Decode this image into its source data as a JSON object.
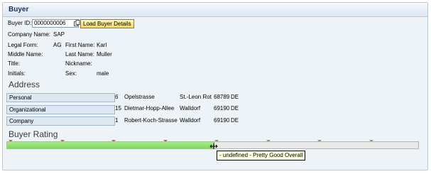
{
  "panel": {
    "title": "Buyer"
  },
  "buyer": {
    "id_label": "Buyer ID:",
    "id_value": "0000000006",
    "load_button": "Load Buyer Details",
    "company_label": "Company Name:",
    "company_value": "SAP",
    "legal_form_label": "Legal Form:",
    "legal_form_value": "AG",
    "first_name_label": "First Name:",
    "first_name_value": "Karl",
    "middle_name_label": "Middle Name:",
    "middle_name_value": "",
    "last_name_label": "Last Name:",
    "last_name_value": "Muller",
    "title_label": "Title:",
    "title_value": "",
    "nickname_label": "Nickname:",
    "nickname_value": "",
    "initials_label": "Initials:",
    "initials_value": "",
    "sex_label": "Sex:",
    "sex_value": "male"
  },
  "address": {
    "title": "Address",
    "rows": [
      {
        "type": "Personal",
        "number": "6",
        "street": "Opelstrasse",
        "city": "St.-Leon Rot",
        "zip": "68789",
        "country": "DE"
      },
      {
        "type": "Organizational",
        "number": "15",
        "street": "Dietmar-Hopp-Allee",
        "city": "Walldorf",
        "zip": "69190",
        "country": "DE"
      },
      {
        "type": "Company",
        "number": "1",
        "street": "Robert-Koch-Strasse",
        "city": "Walldorf",
        "zip": "69190",
        "country": "DE"
      }
    ]
  },
  "rating": {
    "title": "Buyer Rating",
    "level_fraction": 0.5,
    "tick_count": 8,
    "tick_colors": [
      "#d9534f",
      "#d9534f",
      "#d9534f",
      "#d9534f",
      "#7aa65a",
      "#7aa65a",
      "#7aa65a",
      "#7aa65a"
    ],
    "tooltip": "- undefined - Pretty Good Overall"
  },
  "colors": {
    "header_text": "#13305b",
    "fill": "#7fd85a",
    "track": "#e8e8e8"
  },
  "icons": {
    "copy": "copy-icon",
    "cursor": "move-cursor-icon"
  }
}
